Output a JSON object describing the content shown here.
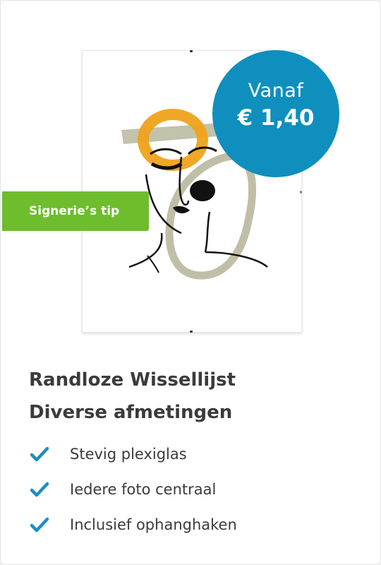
{
  "badge": {
    "price_prefix": "Vanaf",
    "price_value": "€ 1,40",
    "color": "#0f8fbd"
  },
  "tip": {
    "label": "Signerie’s tip",
    "color": "#6ebd2c"
  },
  "product": {
    "title_line1": "Randloze Wissellijst",
    "title_line2": "Diverse afmetingen",
    "image_icon": "framed-artwork-image"
  },
  "features": [
    {
      "label": "Stevig plexiglas",
      "icon": "check-icon"
    },
    {
      "label": "Iedere foto centraal",
      "icon": "check-icon"
    },
    {
      "label": "Inclusief ophanghaken",
      "icon": "check-icon"
    }
  ],
  "colors": {
    "check": "#1a8fc0",
    "text": "#3b3b3b"
  }
}
